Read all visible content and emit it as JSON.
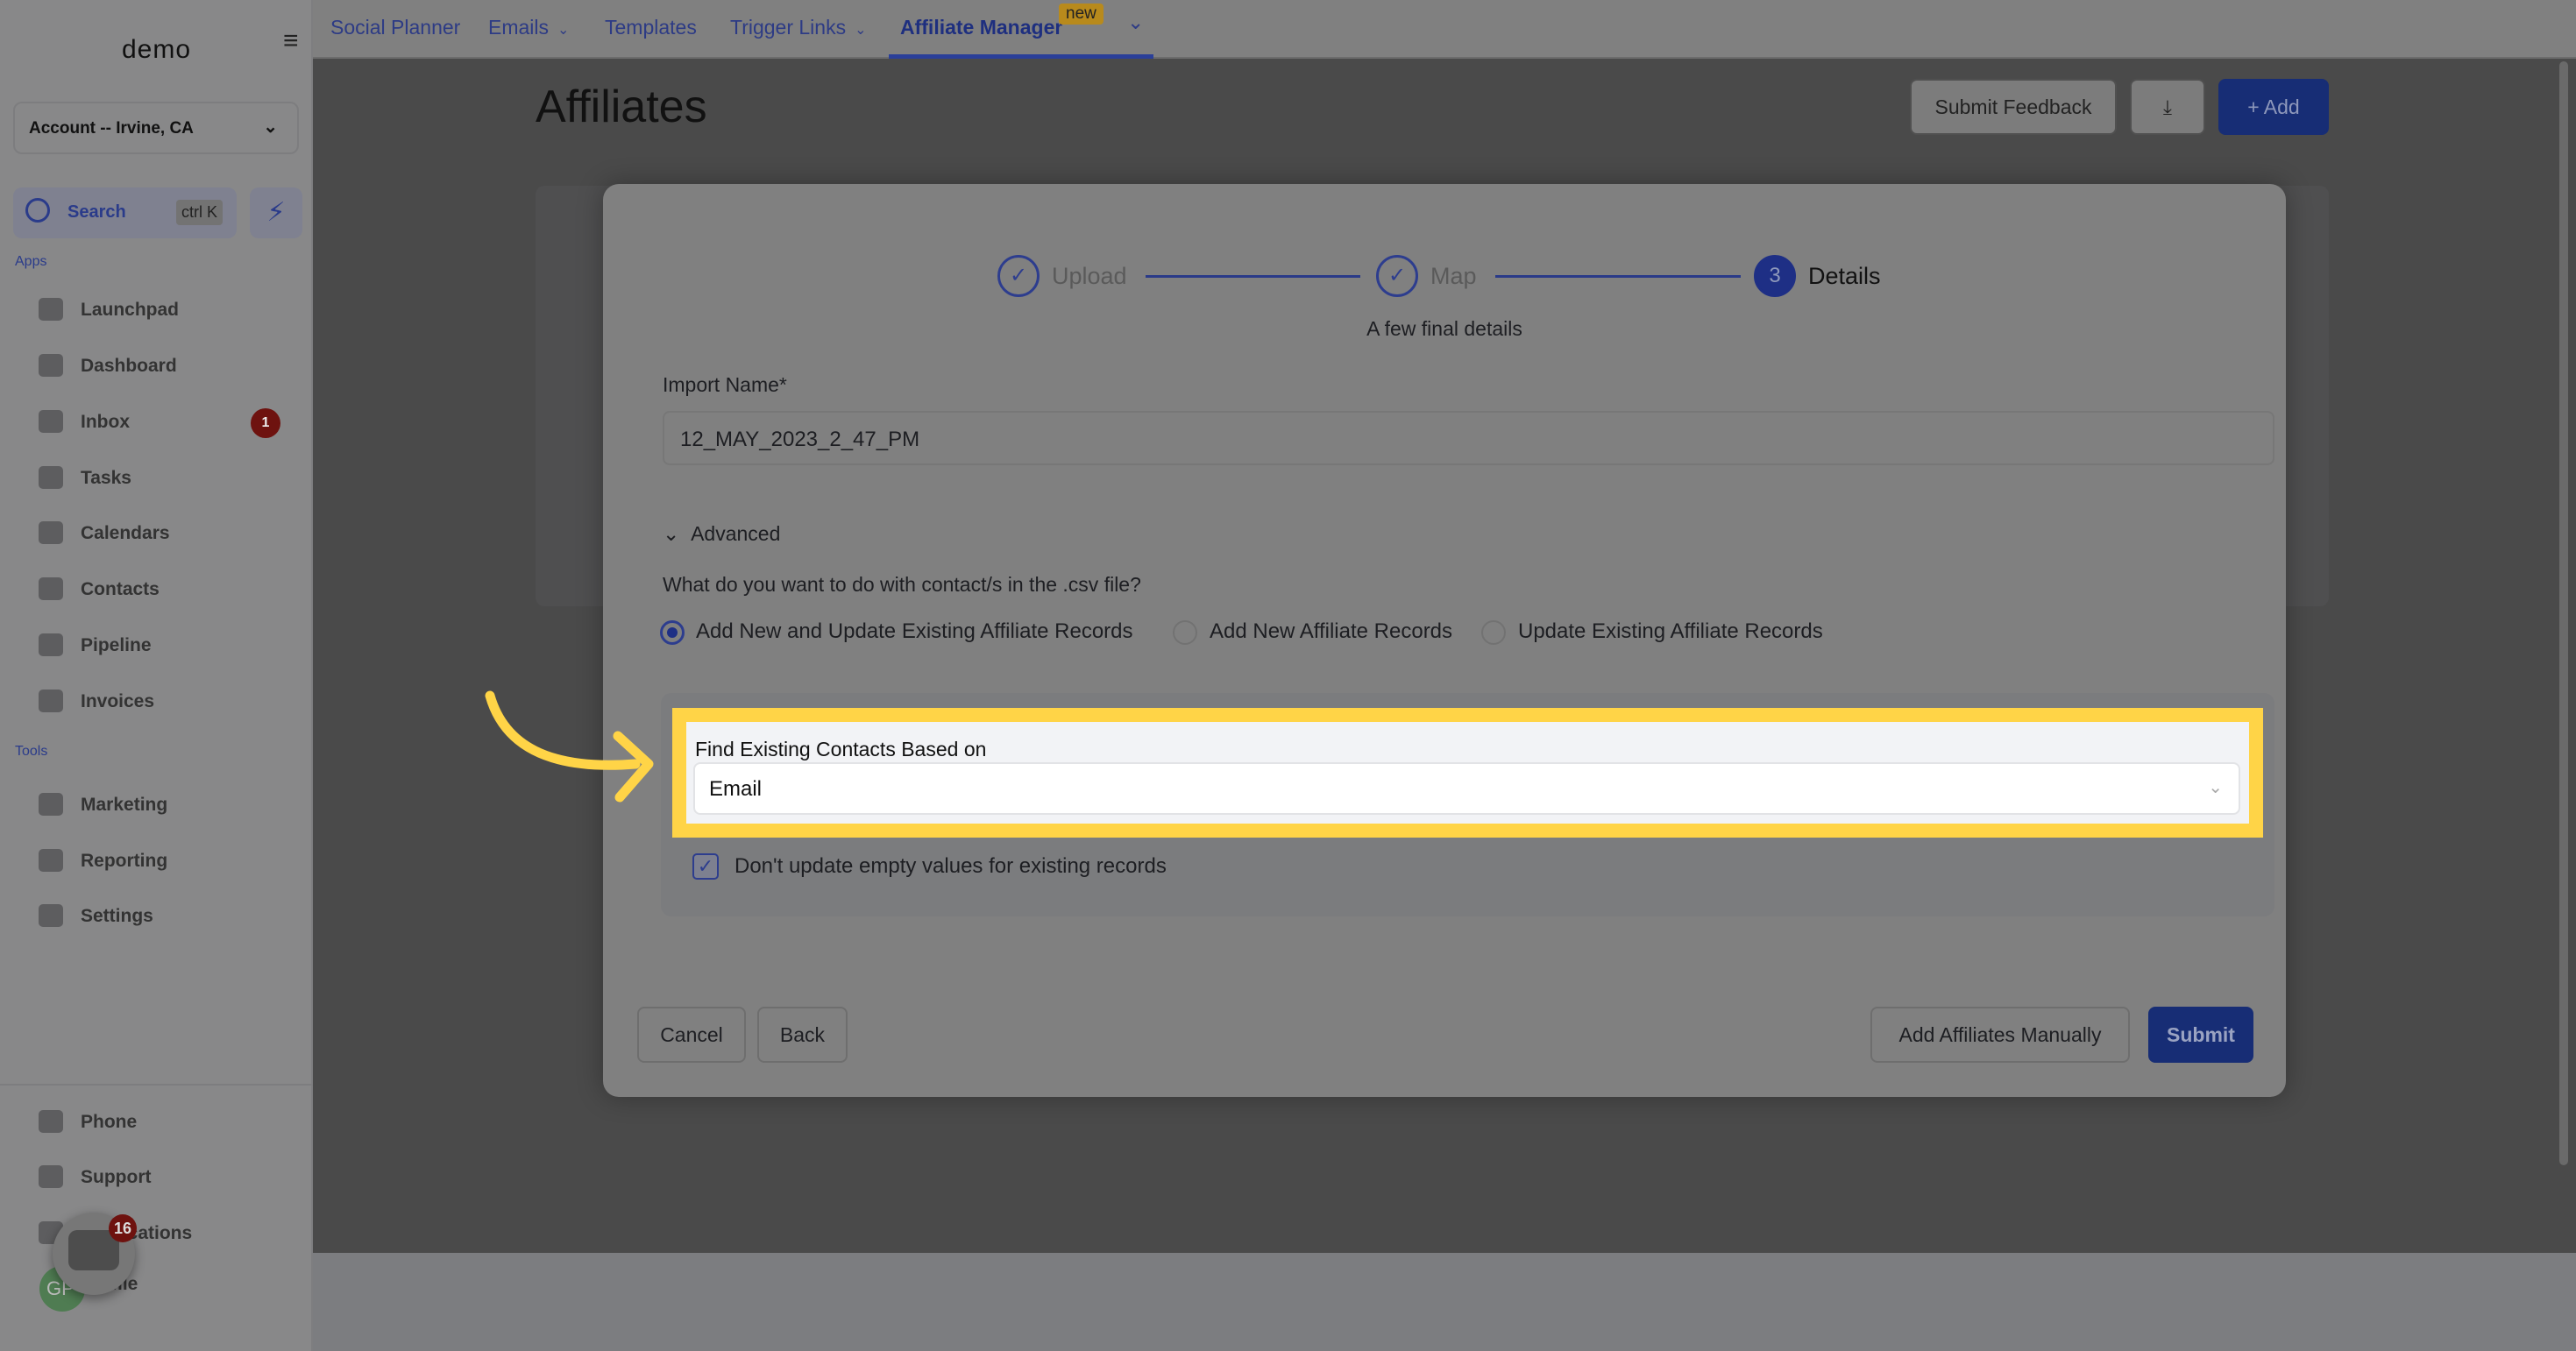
{
  "sidebar": {
    "logo": "demo",
    "account": "Account -- Irvine, CA",
    "search_label": "Search",
    "search_shortcut": "ctrl K",
    "apps_label": "Apps",
    "tools_label": "Tools",
    "apps": [
      {
        "label": "Launchpad",
        "icon": "rocket-icon"
      },
      {
        "label": "Dashboard",
        "icon": "dashboard-icon"
      },
      {
        "label": "Inbox",
        "icon": "inbox-icon",
        "badge": "1"
      },
      {
        "label": "Tasks",
        "icon": "tasks-icon"
      },
      {
        "label": "Calendars",
        "icon": "calendar-icon"
      },
      {
        "label": "Contacts",
        "icon": "contacts-icon"
      },
      {
        "label": "Pipeline",
        "icon": "pipeline-icon"
      },
      {
        "label": "Invoices",
        "icon": "invoice-icon"
      }
    ],
    "tools": [
      {
        "label": "Marketing",
        "icon": "megaphone-icon"
      },
      {
        "label": "Reporting",
        "icon": "pie-chart-icon"
      },
      {
        "label": "Settings",
        "icon": "gear-icon"
      }
    ],
    "bottom": [
      {
        "label": "Phone",
        "icon": "phone-icon"
      },
      {
        "label": "Support",
        "icon": "support-icon"
      },
      {
        "label": "Notifications",
        "icon": "bell-icon"
      },
      {
        "label": "Profile",
        "icon": "avatar"
      }
    ],
    "avatar_initials": "GP",
    "chat_badge": "16"
  },
  "topnav": {
    "tabs": [
      {
        "label": "Social Planner"
      },
      {
        "label": "Emails"
      },
      {
        "label": "Templates"
      },
      {
        "label": "Trigger Links"
      },
      {
        "label": "Affiliate Manager"
      }
    ],
    "new_badge": "new"
  },
  "page": {
    "title": "Affiliates",
    "submit_feedback": "Submit Feedback",
    "add_label": "+ Add"
  },
  "modal": {
    "steps": [
      {
        "label": "Upload",
        "state": "done"
      },
      {
        "label": "Map",
        "state": "done"
      },
      {
        "label": "Details",
        "number": "3",
        "state": "active"
      }
    ],
    "subtitle": "A few final details",
    "import_name_label": "Import Name*",
    "import_name_value": "12_MAY_2023_2_47_PM",
    "advanced_label": "Advanced",
    "question": "What do you want to do with contact/s in the .csv file?",
    "options": [
      {
        "label": "Add New and Update Existing Affiliate Records",
        "selected": true
      },
      {
        "label": "Add New Affiliate Records",
        "selected": false
      },
      {
        "label": "Update Existing Affiliate Records",
        "selected": false
      }
    ],
    "find_label": "Find Existing Contacts Based on",
    "find_value": "Email",
    "checkbox_label": "Don't update empty values for existing records",
    "checkbox_checked": true,
    "cancel": "Cancel",
    "back": "Back",
    "add_manually": "Add Affiliates Manually",
    "submit": "Submit"
  },
  "colors": {
    "accent": "#1e2f85",
    "highlight": "#ffd447",
    "badge": "#6e120f"
  }
}
